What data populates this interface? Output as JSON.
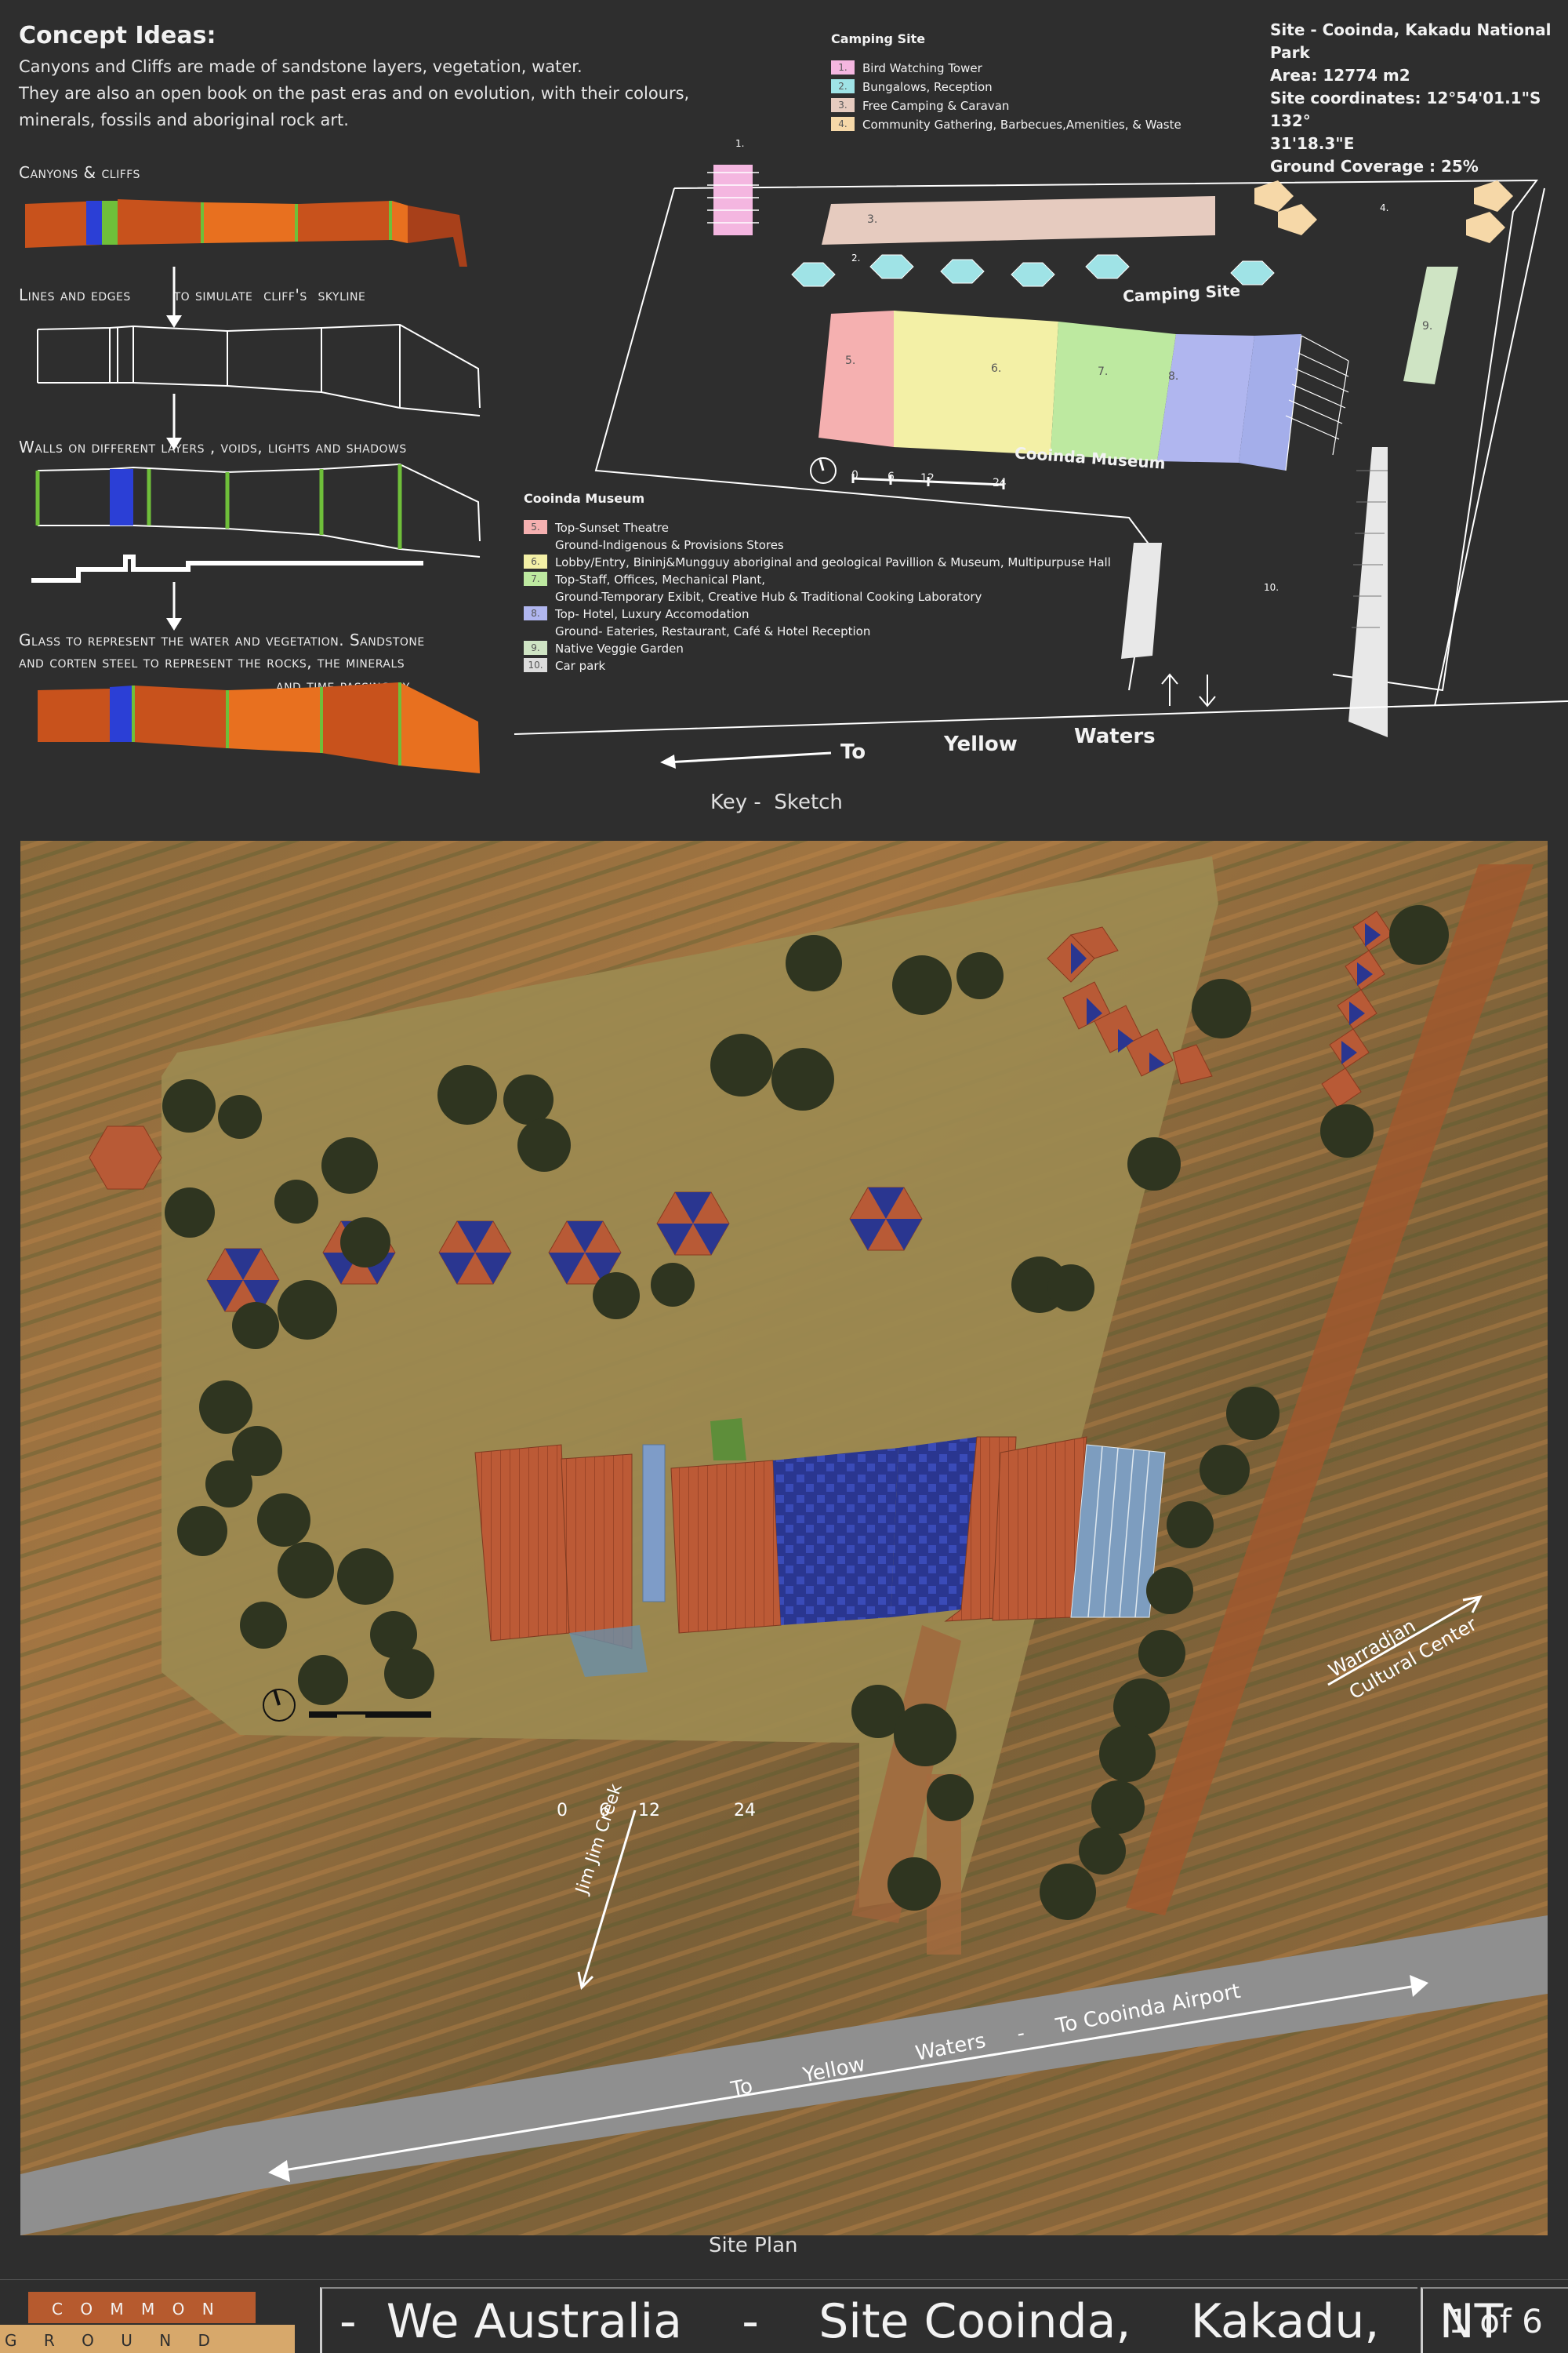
{
  "concept": {
    "title": "Concept Ideas:",
    "lines": [
      "Canyons and Cliffs are made of sandstone layers, vegetation, water.",
      "They are also an open book on the past eras and on evolution, with their colours,",
      "minerals, fossils and aboriginal rock art."
    ],
    "steps": [
      "Canyons & cliffs",
      "Lines and edges        to simulate  cliff's  skyline",
      "Walls on different layers , voids, lights and shadows",
      "Glass to represent the water and vegetation. Sandstone",
      "and corten steel to represent the rocks, the minerals",
      "and time passing by"
    ]
  },
  "camping_legend": {
    "title": "Camping Site",
    "items": [
      {
        "num": "1.",
        "label": "Bird Watching Tower",
        "color": "#f4b6e0"
      },
      {
        "num": "2.",
        "label": "Bungalows,  Reception",
        "color": "#9fe3e6"
      },
      {
        "num": "3.",
        "label": "Free Camping & Caravan",
        "color": "#e6cbbf"
      },
      {
        "num": "4.",
        "label": "Community Gathering, Barbecues,Amenities, &  Waste",
        "color": "#f6d8a8"
      }
    ]
  },
  "site_info": {
    "lines": [
      "Site - Cooinda, Kakadu National Park",
      "Area: 12774 m2",
      "Site coordinates: 12°54'01.1\"S 132°",
      "31'18.3\"E",
      "Ground Coverage : 25%"
    ]
  },
  "museum_legend": {
    "title": "Cooinda Museum",
    "items": [
      {
        "num": "5.",
        "label": "Top-Sunset Theatre",
        "color": "#f5b0b0"
      },
      {
        "num": "",
        "label": "Ground-Indigenous & Provisions Stores",
        "color": ""
      },
      {
        "num": "6.",
        "label": "Lobby/Entry, Bininj&Mungguy aboriginal and geological Pavillion & Museum, Multipurpuse Hall",
        "color": "#f3f0a6"
      },
      {
        "num": "7.",
        "label": "Top-Staff, Offices, Mechanical Plant,",
        "color": "#bde9a0"
      },
      {
        "num": "",
        "label": "Ground-Temporary Exibit, Creative Hub & Traditional Cooking   Laboratory",
        "color": ""
      },
      {
        "num": "8.",
        "label": "Top- Hotel, Luxury Accomodation",
        "color": "#b0b6ef"
      },
      {
        "num": "",
        "label": "Ground- Eateries, Restaurant, Café & Hotel Reception",
        "color": ""
      },
      {
        "num": "9.",
        "label": "Native Veggie Garden",
        "color": "#cfe4c4"
      },
      {
        "num": "10.",
        "label": "Car park",
        "color": "#dcdcdc"
      }
    ]
  },
  "sketch": {
    "camping_label": "Camping Site",
    "museum_label": "Cooinda Museum",
    "scale": [
      "0",
      "6",
      "12",
      "24"
    ],
    "road": [
      "To",
      "Yellow",
      "Waters"
    ],
    "caption": "Key -  Sketch",
    "nums": [
      "1.",
      "2.",
      "3.",
      "4.",
      "5.",
      "6.",
      "7.",
      "8.",
      "9.",
      "10."
    ]
  },
  "site_plan": {
    "scale": [
      "0",
      "6",
      "12",
      "24"
    ],
    "road_label": "To        Yellow        Waters     -     To Cooinda Airport",
    "creek_label": "Jim Jim Creek",
    "cultural_label_1": "Warradjan",
    "cultural_label_2": "Cultural Center",
    "caption": "Site Plan"
  },
  "footer": {
    "logo_top": "C O M M O N",
    "logo_bottom": "G R O U N D",
    "title": "-  We Australia    -    Site Cooinda,    Kakadu,    NT",
    "page": "1 of 6"
  },
  "colors": {
    "background": "#2e2e2e",
    "sandstone": "#c8521c",
    "corten": "#e8701f",
    "glass_blue": "#2b3fd6",
    "vegetation": "#6fbf3a",
    "site_ground": "#a08c55",
    "road": "#8f8f8f"
  }
}
